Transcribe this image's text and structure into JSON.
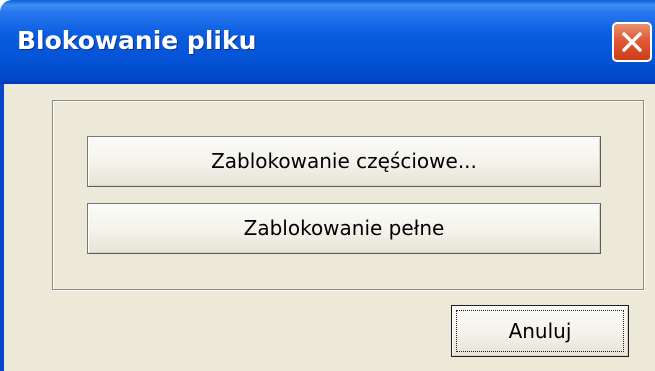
{
  "dialog": {
    "title": "Blokowanie pliku",
    "close_label": "×"
  },
  "buttons": {
    "partial_lock_label": "Zablokowanie częściowe...",
    "full_lock_label": "Zablokowanie pełne",
    "cancel_label_prefix": "Anulu",
    "cancel_label_mnemonic": "j"
  },
  "colors": {
    "titlebar": "#0553d6",
    "client_background": "#ece9d8",
    "close_button": "#df5a36"
  },
  "icons": {
    "close": "close-icon"
  }
}
